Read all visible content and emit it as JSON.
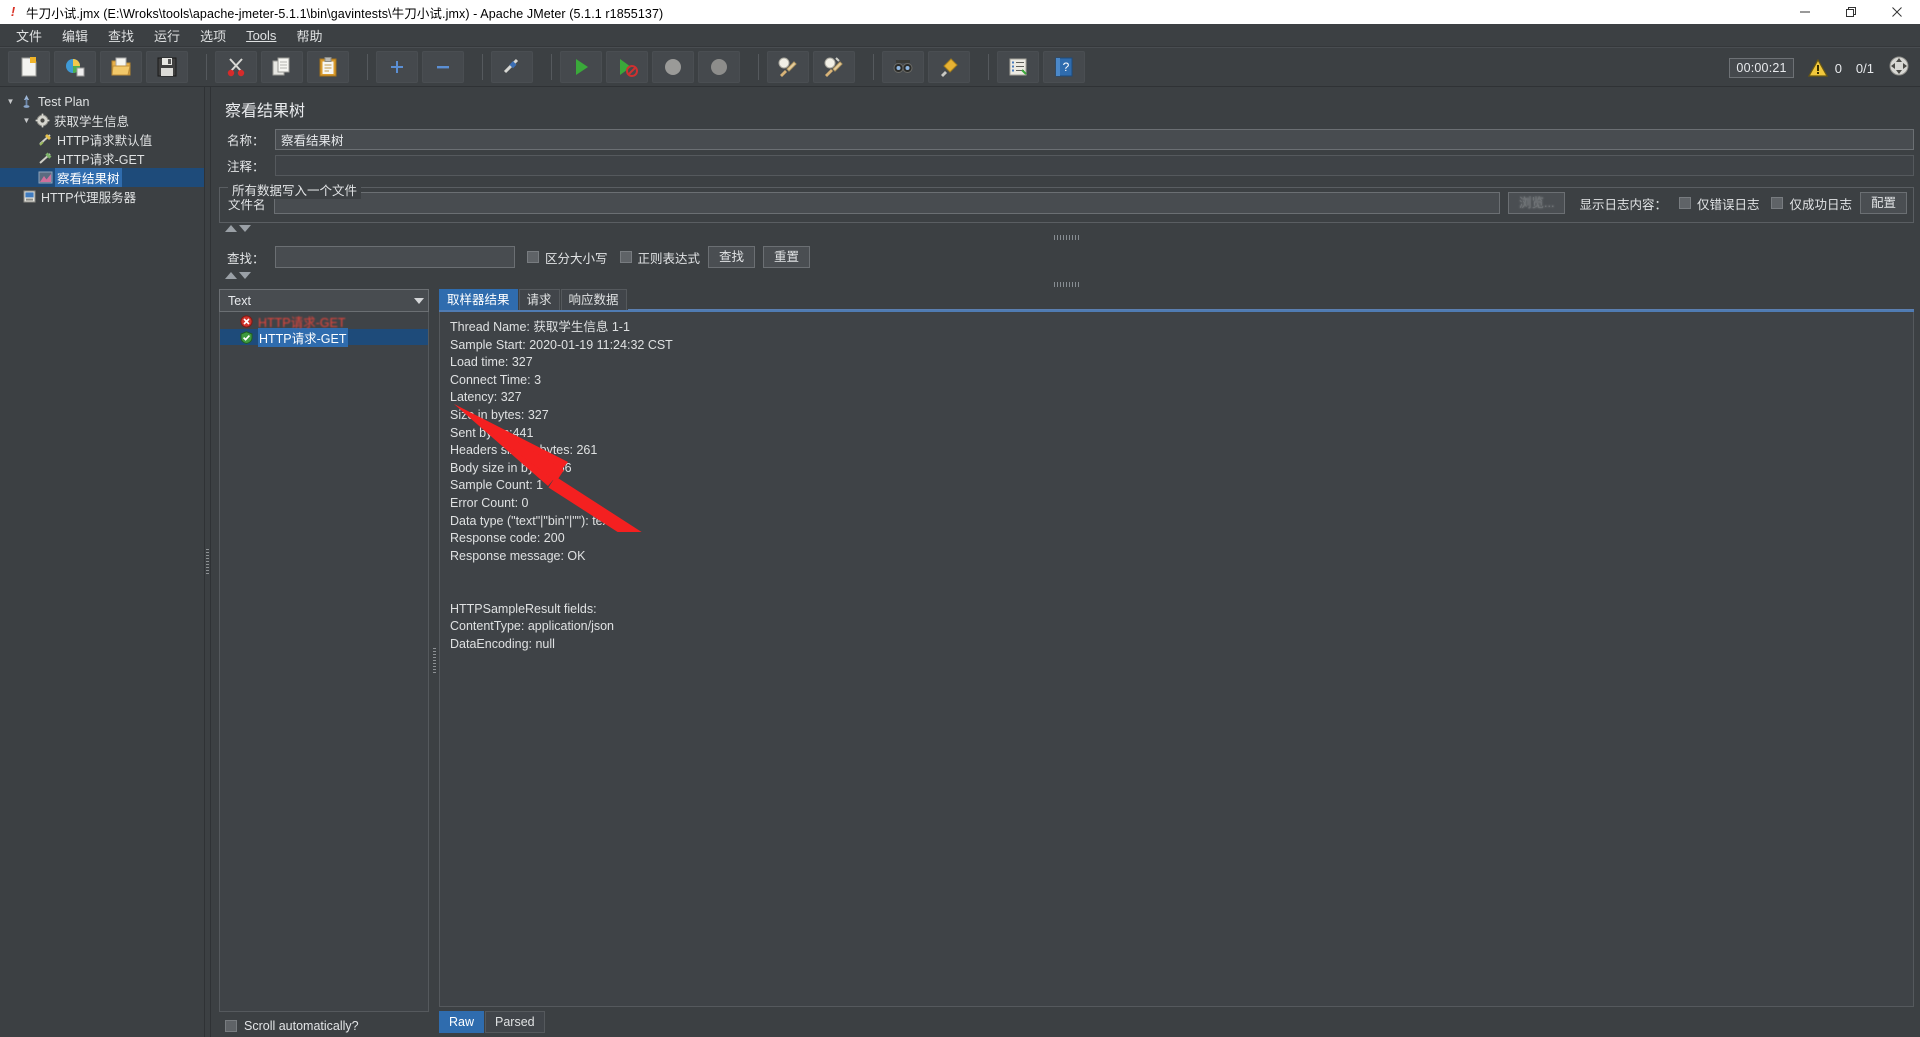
{
  "titlebar": {
    "title": "牛刀小试.jmx (E:\\Wroks\\tools\\apache-jmeter-5.1.1\\bin\\gavintests\\牛刀小试.jmx) - Apache JMeter (5.1.1 r1855137)",
    "app_icon": "jmeter-icon",
    "minimize": "—",
    "maximize": "❐",
    "close": "✕"
  },
  "menu": {
    "items": [
      {
        "label": "文件",
        "name": "menu-file"
      },
      {
        "label": "编辑",
        "name": "menu-edit"
      },
      {
        "label": "查找",
        "name": "menu-search"
      },
      {
        "label": "运行",
        "name": "menu-run"
      },
      {
        "label": "选项",
        "name": "menu-options"
      },
      {
        "label": "Tools",
        "name": "menu-tools"
      },
      {
        "label": "帮助",
        "name": "menu-help"
      }
    ]
  },
  "toolbar": {
    "buttons": [
      {
        "name": "new-button",
        "icon": "new-document-icon"
      },
      {
        "name": "templates-button",
        "icon": "templates-icon"
      },
      {
        "name": "open-button",
        "icon": "open-folder-icon"
      },
      {
        "name": "save-button",
        "icon": "save-disk-icon"
      },
      {
        "name": "cut-button",
        "icon": "scissors-icon"
      },
      {
        "name": "copy-button",
        "icon": "copy-icon"
      },
      {
        "name": "paste-button",
        "icon": "clipboard-icon"
      },
      {
        "name": "expand-all-button",
        "icon": "plus-icon"
      },
      {
        "name": "collapse-all-button",
        "icon": "minus-icon"
      },
      {
        "name": "toggle-button",
        "icon": "toggle-icon"
      },
      {
        "name": "start-button",
        "icon": "green-play-icon"
      },
      {
        "name": "start-no-pauses-button",
        "icon": "green-play-nopause-icon"
      },
      {
        "name": "stop-button",
        "icon": "stop-icon"
      },
      {
        "name": "shutdown-button",
        "icon": "shutdown-icon"
      },
      {
        "name": "clear-button",
        "icon": "clear-broom-icon"
      },
      {
        "name": "clear-all-button",
        "icon": "clear-all-broom-icon"
      },
      {
        "name": "search-button",
        "icon": "binoculars-icon"
      },
      {
        "name": "reset-search-button",
        "icon": "reset-search-icon"
      },
      {
        "name": "function-helper-button",
        "icon": "function-helper-icon"
      },
      {
        "name": "help-button",
        "icon": "help-book-icon"
      }
    ],
    "timer": "00:00:21",
    "warning_icon": "warning-triangle-icon",
    "warning_count": "0",
    "thread_count": "0/1",
    "expand_icon": "expand-arrows-icon"
  },
  "tree": {
    "nodes": [
      {
        "label": "Test Plan",
        "indent": 1,
        "twist": "▼",
        "icon": "test-plan-icon",
        "selected": false,
        "name": "tree-node-test-plan"
      },
      {
        "label": "获取学生信息",
        "indent": 2,
        "twist": "▼",
        "icon": "thread-group-icon",
        "selected": false,
        "name": "tree-node-thread-group"
      },
      {
        "label": "HTTP请求默认值",
        "indent": 3,
        "twist": "",
        "icon": "http-defaults-icon",
        "selected": false,
        "name": "tree-node-http-defaults"
      },
      {
        "label": "HTTP请求-GET",
        "indent": 3,
        "twist": "",
        "icon": "http-request-icon",
        "selected": false,
        "name": "tree-node-http-request"
      },
      {
        "label": "察看结果树",
        "indent": 3,
        "twist": "",
        "icon": "view-results-tree-icon",
        "selected": true,
        "name": "tree-node-view-results-tree"
      },
      {
        "label": "HTTP代理服务器",
        "indent": 2,
        "twist": "",
        "icon": "http-proxy-icon",
        "selected": false,
        "name": "tree-node-http-proxy"
      }
    ]
  },
  "panel": {
    "title": "察看结果树",
    "name_label": "名称：",
    "name_value": "察看结果树",
    "comment_label": "注释：",
    "comment_value": "",
    "group_title": "所有数据写入一个文件",
    "filename_label": "文件名",
    "filename_value": "",
    "browse_button": "浏览...",
    "log_display_label": "显示日志内容：",
    "errors_only_label": "仅错误日志",
    "successes_only_label": "仅成功日志",
    "configure_button": "配置",
    "search_label": "查找：",
    "search_value": "",
    "case_sensitive_label": "区分大小写",
    "regex_label": "正则表达式",
    "find_button": "查找",
    "reset_button": "重置"
  },
  "results": {
    "render_selected": "Text",
    "render_caret_icon": "chevron-down-icon",
    "entries": [
      {
        "label": "HTTP请求-GET",
        "status": "error",
        "icon": "error-circle-icon",
        "selected": false,
        "name": "result-entry-error"
      },
      {
        "label": "HTTP请求-GET",
        "status": "success",
        "icon": "success-shield-icon",
        "selected": true,
        "name": "result-entry-success"
      }
    ],
    "scroll_automatically_label": "Scroll automatically?",
    "tabs": [
      {
        "label": "取样器结果",
        "active": true,
        "name": "tab-sampler-result"
      },
      {
        "label": "请求",
        "active": false,
        "name": "tab-request"
      },
      {
        "label": "响应数据",
        "active": false,
        "name": "tab-response-data"
      }
    ],
    "sampler_result_lines": [
      "Thread Name: 获取学生信息 1-1",
      "Sample Start: 2020-01-19 11:24:32 CST",
      "Load time: 327",
      "Connect Time: 3",
      "Latency: 327",
      "Size in bytes: 327",
      "Sent bytes:441",
      "Headers size in bytes: 261",
      "Body size in bytes: 66",
      "Sample Count: 1",
      "Error Count: 0",
      "Data type (\"text\"|\"bin\"|\"\"): text",
      "Response code: 200",
      "Response message: OK",
      "",
      "",
      "HTTPSampleResult fields:",
      "ContentType: application/json",
      "DataEncoding: null"
    ],
    "bottom_tabs": [
      {
        "label": "Raw",
        "active": true,
        "name": "bottom-tab-raw"
      },
      {
        "label": "Parsed",
        "active": false,
        "name": "bottom-tab-parsed"
      }
    ]
  },
  "annotation": {
    "arrow_color": "#f42020",
    "arrow_name": "red-arrow-annotation"
  }
}
